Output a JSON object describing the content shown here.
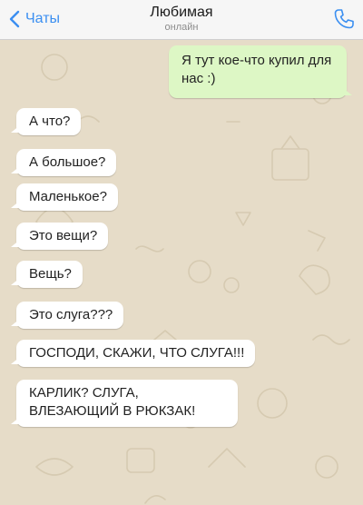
{
  "header": {
    "back_label": "Чаты",
    "contact_name": "Любимая",
    "status": "онлайн"
  },
  "messages": [
    {
      "direction": "out",
      "text": "Я тут кое-что купил для нас :)"
    },
    {
      "direction": "in",
      "text": "А что?"
    },
    {
      "direction": "in",
      "text": "А большое?"
    },
    {
      "direction": "in",
      "text": "Маленькое?"
    },
    {
      "direction": "in",
      "text": "Это вещи?"
    },
    {
      "direction": "in",
      "text": "Вещь?"
    },
    {
      "direction": "in",
      "text": "Это слуга???"
    },
    {
      "direction": "in",
      "text": "ГОСПОДИ, СКАЖИ, ЧТО СЛУГА!!!"
    },
    {
      "direction": "in",
      "text": "КАРЛИК? СЛУГА, ВЛЕЗАЮЩИЙ В РЮКЗАК!"
    }
  ],
  "icons": {
    "back": "chevron-left-icon",
    "call": "phone-icon"
  },
  "colors": {
    "accent": "#3b8ff1",
    "outgoing_bubble": "#ddf7c5",
    "incoming_bubble": "#ffffff",
    "wallpaper": "#e6dcc8"
  }
}
